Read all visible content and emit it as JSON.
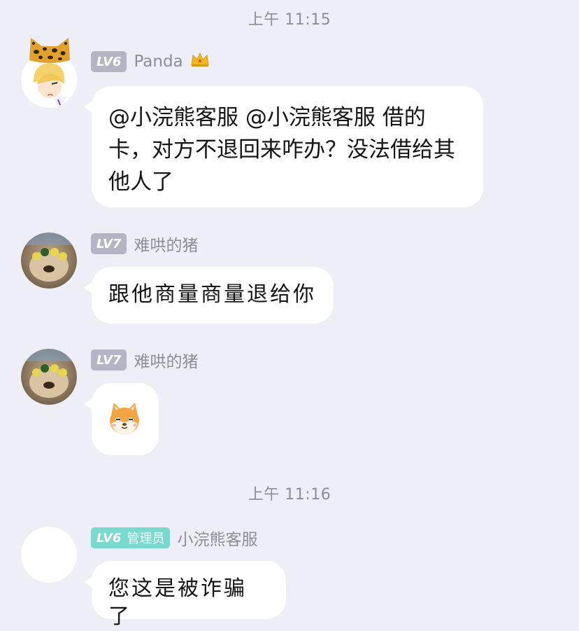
{
  "timestamps": [
    "上午 11:15",
    "上午 11:16"
  ],
  "messages": [
    {
      "level": "LV6",
      "role": "",
      "nickname": "Panda",
      "nickname_badge_icon": "crown-icon",
      "avatar_icon": "anime-boy-leopard-hat-avatar",
      "text": "@小浣熊客服 @小浣熊客服 借的卡，对方不退回来咋办？没法借给其他人了"
    },
    {
      "level": "LV7",
      "role": "",
      "nickname": "难哄的猪",
      "avatar_icon": "dog-flower-crown-avatar",
      "text": "跟他商量商量退给你"
    },
    {
      "level": "LV7",
      "role": "",
      "nickname": "难哄的猪",
      "avatar_icon": "dog-flower-crown-avatar",
      "sticker_icon": "shiba-dog-emoji"
    },
    {
      "level": "LV6",
      "role": "管理员",
      "nickname": "小浣熊客服",
      "avatar_icon": "blank-avatar",
      "text": "您这是被诈骗了"
    }
  ],
  "colors": {
    "background": "#eeeef6",
    "bubble": "#ffffff",
    "level_badge": "#b4b4c4",
    "admin_badge": "#78d9cc",
    "meta_text": "#8d8d96"
  }
}
